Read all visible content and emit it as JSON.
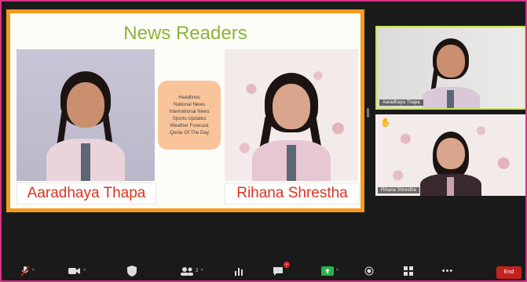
{
  "slide": {
    "title": "News Readers",
    "topics": [
      "Headlines",
      "National News",
      "International News",
      "Sports Updates",
      "Weather Forecast",
      "Quote Of The Day"
    ],
    "left_name": "Aaradhaya Thapa",
    "right_name": "Rihana Shrestha",
    "border_color": "#f39a1f",
    "title_color": "#8ab43a",
    "name_color": "#e0321f"
  },
  "participants": [
    {
      "name": "Aaradhaya Thapa",
      "active_speaker": true
    },
    {
      "name": "Rihana Shrestha",
      "hand_raised": true
    }
  ],
  "toolbar": {
    "items": [
      {
        "icon": "microphone-muted-icon",
        "label": "Unmute"
      },
      {
        "icon": "video-camera-icon",
        "label": "Start Video"
      },
      {
        "icon": "shield-icon",
        "label": "Security"
      },
      {
        "icon": "participants-icon",
        "label": "Participants",
        "count": "2"
      },
      {
        "icon": "polls-icon",
        "label": "Polls"
      },
      {
        "icon": "chat-icon",
        "label": "Chat"
      },
      {
        "icon": "share-screen-icon",
        "label": "Share Screen"
      },
      {
        "icon": "record-icon",
        "label": "Record"
      },
      {
        "icon": "breakout-rooms-icon",
        "label": "Breakout Rooms"
      },
      {
        "icon": "more-icon",
        "label": "More"
      }
    ],
    "end_label": "End",
    "accent_share": "#2bb34a",
    "end_color": "#c5221f"
  }
}
